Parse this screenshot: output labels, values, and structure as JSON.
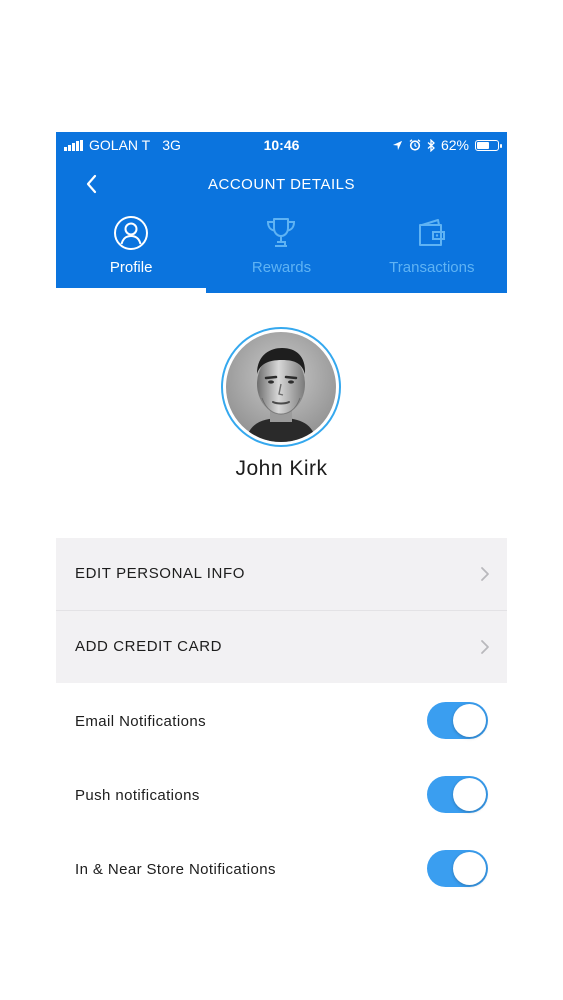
{
  "status_bar": {
    "carrier": "GOLAN T",
    "network": "3G",
    "time": "10:46",
    "battery": "62%",
    "battery_level": 0.62,
    "icons": [
      "signal-bars-icon",
      "location-arrow-icon",
      "alarm-icon",
      "bluetooth-icon",
      "battery-icon"
    ]
  },
  "nav": {
    "title": "ACCOUNT DETAILS",
    "back_icon": "chevron-left-icon"
  },
  "tabs": [
    {
      "label": "Profile",
      "icon": "user-circle-icon",
      "active": true
    },
    {
      "label": "Rewards",
      "icon": "trophy-icon",
      "active": false
    },
    {
      "label": "Transactions",
      "icon": "wallet-icon",
      "active": false
    }
  ],
  "profile": {
    "name": "John Kirk",
    "avatar_icon": "user-avatar-photo"
  },
  "menu": [
    {
      "label": "EDIT PERSONAL INFO",
      "icon": "chevron-right-icon"
    },
    {
      "label": "ADD CREDIT CARD",
      "icon": "chevron-right-icon"
    }
  ],
  "settings": [
    {
      "label": "Email Notifications",
      "enabled": true
    },
    {
      "label": "Push notifications",
      "enabled": true
    },
    {
      "label": "In & Near Store Notifications",
      "enabled": true
    }
  ],
  "colors": {
    "header_bg": "#0b74de",
    "tab_inactive": "#5fb3f4",
    "toggle_on": "#3a9ef0",
    "menu_bg": "#f2f1f3",
    "avatar_ring": "#35a8ee"
  }
}
